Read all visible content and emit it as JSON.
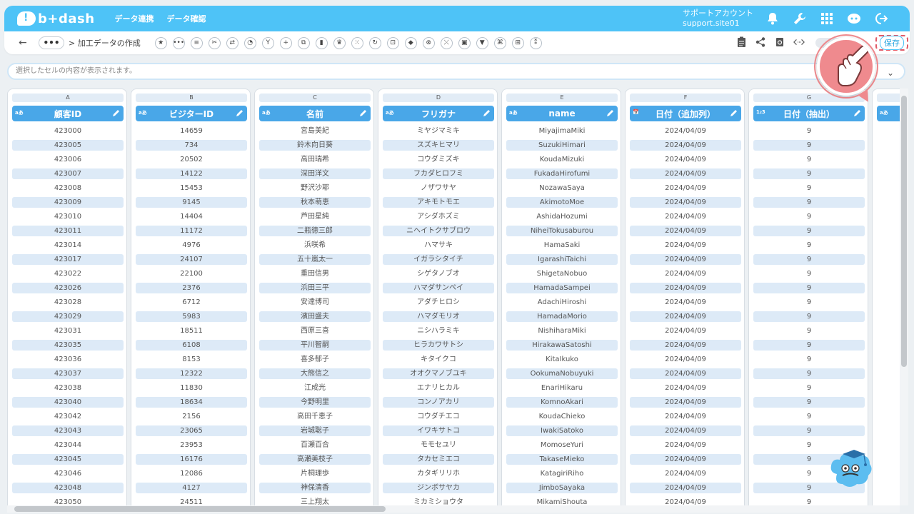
{
  "header": {
    "logo_text": "b+dash",
    "nav": [
      "データ連携",
      "データ確認"
    ],
    "account_name": "サポートアカウント",
    "account_site": "support.site01",
    "brand_color": "#4ec3f7"
  },
  "toolbar": {
    "back_label": "←",
    "more_label": "•••",
    "breadcrumb": "> 加工データの作成",
    "tools": [
      "★",
      "•••",
      "≡",
      "✂",
      "⇄",
      "◔",
      "Y",
      "+",
      "⧉",
      "▮",
      "♛",
      "⁙",
      "↻",
      "⊡",
      "◆",
      "⊗",
      "⤬",
      "▣",
      "▼",
      "⌘",
      "⊞",
      "⁑"
    ],
    "right_icons": [
      "clipboard-icon",
      "share-icon",
      "refresh-icon",
      "code-icon"
    ],
    "save_label": "保存"
  },
  "cellbar": {
    "placeholder": "選択したセルの内容が表示されます。"
  },
  "columns": [
    {
      "letter": "A",
      "type": "aあ",
      "name": "顧客ID"
    },
    {
      "letter": "B",
      "type": "aあ",
      "name": "ビジターID"
    },
    {
      "letter": "C",
      "type": "aあ",
      "name": "名前"
    },
    {
      "letter": "D",
      "type": "aあ",
      "name": "フリガナ"
    },
    {
      "letter": "E",
      "type": "aあ",
      "name": "name"
    },
    {
      "letter": "F",
      "type": "📅",
      "name": "日付（追加列）"
    },
    {
      "letter": "G",
      "type": "1₂3",
      "name": "日付（抽出）"
    },
    {
      "letter": "",
      "type": "aあ",
      "name": ""
    }
  ],
  "rows": [
    [
      "423000",
      "14659",
      "宮島美紀",
      "ミヤジマミキ",
      "MiyajimaMiki",
      "2024/04/09",
      "9"
    ],
    [
      "423005",
      "734",
      "鈴木向日葵",
      "スズキヒマリ",
      "SuzukiHimari",
      "2024/04/09",
      "9"
    ],
    [
      "423006",
      "20502",
      "高田瑞希",
      "コウダミズキ",
      "KoudaMizuki",
      "2024/04/09",
      "9"
    ],
    [
      "423007",
      "14122",
      "深田洋文",
      "フカダヒロフミ",
      "FukadaHirofumi",
      "2024/04/09",
      "9"
    ],
    [
      "423008",
      "15453",
      "野沢沙耶",
      "ノザワサヤ",
      "NozawaSaya",
      "2024/04/09",
      "9"
    ],
    [
      "423009",
      "9145",
      "秋本萌恵",
      "アキモトモエ",
      "AkimotoMoe",
      "2024/04/09",
      "9"
    ],
    [
      "423010",
      "14404",
      "芦田星純",
      "アシダホズミ",
      "AshidaHozumi",
      "2024/04/09",
      "9"
    ],
    [
      "423011",
      "11172",
      "二瓶徳三郎",
      "ニヘイトクサブロウ",
      "NiheiTokusaburou",
      "2024/04/09",
      "9"
    ],
    [
      "423014",
      "4976",
      "浜咲希",
      "ハマサキ",
      "HamaSaki",
      "2024/04/09",
      "9"
    ],
    [
      "423017",
      "24107",
      "五十嵐太一",
      "イガラシタイチ",
      "IgarashiTaichi",
      "2024/04/09",
      "9"
    ],
    [
      "423022",
      "22100",
      "重田信男",
      "シゲタノブオ",
      "ShigetaNobuo",
      "2024/04/09",
      "9"
    ],
    [
      "423026",
      "2376",
      "浜田三平",
      "ハマダサンペイ",
      "HamadaSampei",
      "2024/04/09",
      "9"
    ],
    [
      "423028",
      "6712",
      "安達博司",
      "アダチヒロシ",
      "AdachiHiroshi",
      "2024/04/09",
      "9"
    ],
    [
      "423029",
      "5983",
      "濱田盛夫",
      "ハマダモリオ",
      "HamadaMorio",
      "2024/04/09",
      "9"
    ],
    [
      "423031",
      "18511",
      "西原三喜",
      "ニシハラミキ",
      "NishiharaMiki",
      "2024/04/09",
      "9"
    ],
    [
      "423035",
      "6108",
      "平川智嗣",
      "ヒラカワサトシ",
      "HirakawaSatoshi",
      "2024/04/09",
      "9"
    ],
    [
      "423036",
      "8153",
      "喜多郁子",
      "キタイクコ",
      "KitaIkuko",
      "2024/04/09",
      "9"
    ],
    [
      "423037",
      "12322",
      "大熊信之",
      "オオクマノブユキ",
      "OokumaNobuyuki",
      "2024/04/09",
      "9"
    ],
    [
      "423038",
      "11830",
      "江成光",
      "エナリヒカル",
      "EnariHikaru",
      "2024/04/09",
      "9"
    ],
    [
      "423040",
      "18634",
      "今野明里",
      "コンノアカリ",
      "KomnoAkari",
      "2024/04/09",
      "9"
    ],
    [
      "423042",
      "2156",
      "高田千恵子",
      "コウダチエコ",
      "KoudaChieko",
      "2024/04/09",
      "9"
    ],
    [
      "423043",
      "23065",
      "岩城聡子",
      "イワキサトコ",
      "IwakiSatoko",
      "2024/04/09",
      "9"
    ],
    [
      "423044",
      "23953",
      "百瀬百合",
      "モモセユリ",
      "MomoseYuri",
      "2024/04/09",
      "9"
    ],
    [
      "423045",
      "16176",
      "高瀬美枝子",
      "タカセミエコ",
      "TakaseMieko",
      "2024/04/09",
      "9"
    ],
    [
      "423046",
      "12086",
      "片桐理歩",
      "カタギリリホ",
      "KatagiriRiho",
      "2024/04/09",
      "9"
    ],
    [
      "423048",
      "4127",
      "神保清香",
      "ジンボサヤカ",
      "JimboSayaka",
      "2024/04/09",
      "9"
    ],
    [
      "423050",
      "24511",
      "三上翔太",
      "ミカミショウタ",
      "MikamiShouta",
      "2024/04/09",
      "9"
    ]
  ]
}
